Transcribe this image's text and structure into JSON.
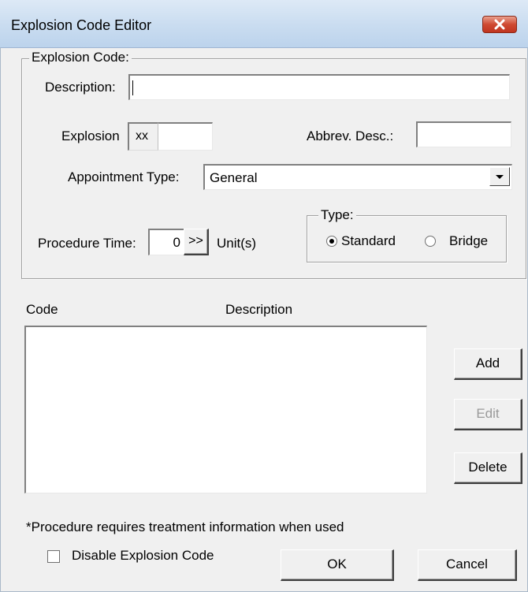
{
  "window": {
    "title": "Explosion Code Editor"
  },
  "group_explosion_code": {
    "legend": "Explosion Code:",
    "description_label": "Description:",
    "description_value": "",
    "explosion_label": "Explosion",
    "explosion_prefix": "xx",
    "explosion_value": "",
    "abbrev_label": "Abbrev. Desc.:",
    "abbrev_value": "",
    "appointment_type_label": "Appointment Type:",
    "appointment_type_value": "General",
    "procedure_time_label": "Procedure Time:",
    "procedure_time_value": "0",
    "procedure_time_button": ">>",
    "units_label": "Unit(s)"
  },
  "group_type": {
    "legend": "Type:",
    "options": [
      {
        "label": "Standard",
        "selected": true
      },
      {
        "label": "Bridge",
        "selected": false
      }
    ]
  },
  "codes_list": {
    "columns": [
      "Code",
      "Description"
    ],
    "rows": []
  },
  "side_buttons": {
    "add": "Add",
    "edit": "Edit",
    "delete": "Delete",
    "edit_disabled": true
  },
  "note": "*Procedure requires treatment information when used",
  "disable_checkbox": {
    "label": "Disable Explosion Code",
    "checked": false
  },
  "footer": {
    "ok": "OK",
    "cancel": "Cancel"
  },
  "colors": {
    "titlebar": "#c9dcf0",
    "close_button": "#cf4a32",
    "dialog_bg": "#f0f0f0"
  }
}
